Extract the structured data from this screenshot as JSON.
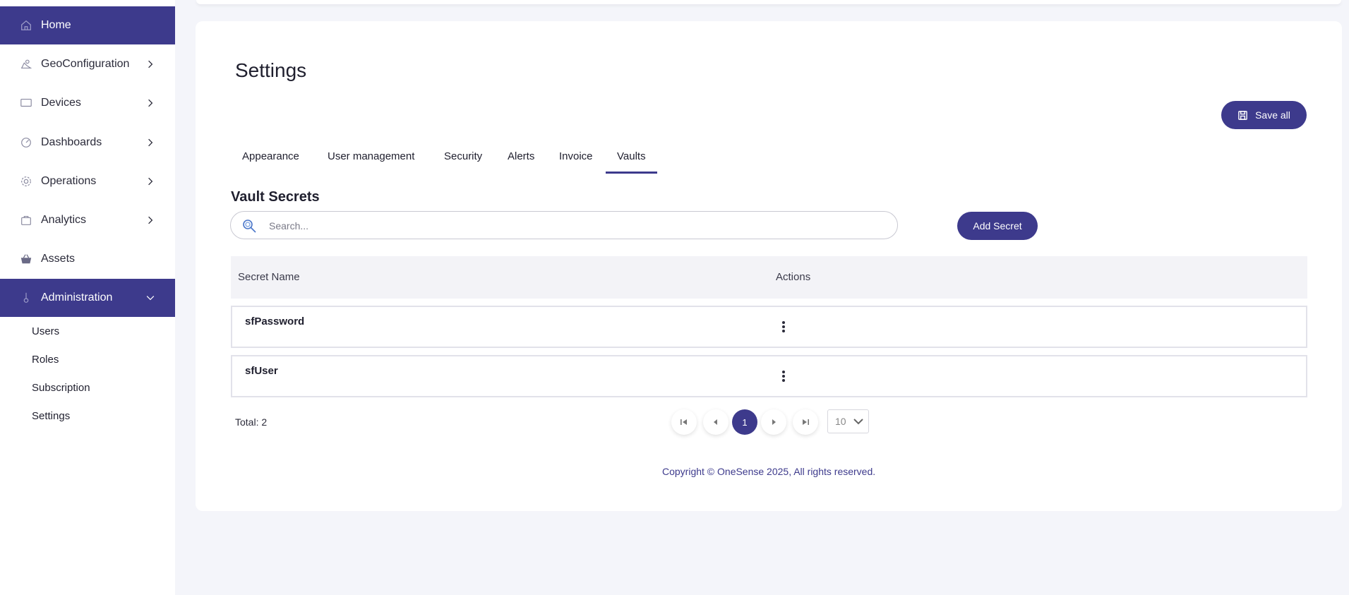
{
  "sidebar": {
    "items": [
      {
        "label": "Home",
        "icon": "home-icon",
        "active": true
      },
      {
        "label": "GeoConfiguration",
        "icon": "map-icon"
      },
      {
        "label": "Devices",
        "icon": "monitor-icon"
      },
      {
        "label": "Dashboards",
        "icon": "gauge-icon"
      },
      {
        "label": "Operations",
        "icon": "gear-icon"
      },
      {
        "label": "Analytics",
        "icon": "bag-icon"
      },
      {
        "label": "Assets",
        "icon": "basket-icon"
      },
      {
        "label": "Administration",
        "icon": "admin-icon",
        "expanded": true
      }
    ],
    "sub_items": [
      "Users",
      "Roles",
      "Subscription",
      "Settings"
    ]
  },
  "page": {
    "title": "Settings",
    "save_label": "Save all"
  },
  "tabs": [
    "Appearance",
    "User management",
    "Security",
    "Alerts",
    "Invoice",
    "Vaults"
  ],
  "active_tab": "Vaults",
  "vault": {
    "title": "Vault Secrets",
    "search_placeholder": "Search...",
    "add_label": "Add Secret",
    "columns": [
      "Secret Name",
      "Actions"
    ],
    "rows": [
      {
        "name": "sfPassword"
      },
      {
        "name": "sfUser"
      }
    ],
    "total": "Total: 2",
    "current_page": "1",
    "page_size": "10"
  },
  "footer": {
    "copyright": "Copyright © OneSense 2025, All rights reserved."
  },
  "colors": {
    "accent": "#3d3a8c",
    "background": "#f4f5fa"
  }
}
